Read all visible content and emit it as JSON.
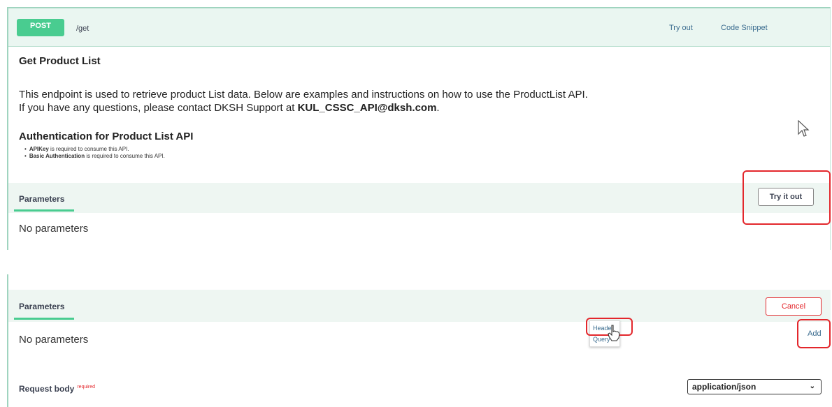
{
  "endpoint": {
    "method": "POST",
    "path": "/get",
    "try_out": "Try out",
    "code_snippet": "Code Snippet"
  },
  "description": {
    "title": "Get Product List",
    "line1": "This endpoint is used to retrieve product List data. Below are examples and instructions on how to use the ProductList API.",
    "line2_prefix": "If you have any questions, please contact DKSH Support at ",
    "line2_email": "KUL_CSSC_API@dksh.com",
    "line2_suffix": ".",
    "auth_title": "Authentication for Product List API",
    "auth_items": [
      {
        "bold": "APIKey",
        "rest": " is required to consume this API."
      },
      {
        "bold": "Basic Authentication",
        "rest": " is required to consume this API."
      }
    ]
  },
  "params_top": {
    "tab_label": "Parameters",
    "empty_text": "No parameters",
    "try_it_out": "Try it out"
  },
  "params_bottom": {
    "tab_label": "Parameters",
    "empty_text": "No parameters",
    "cancel": "Cancel",
    "add": "Add",
    "add_menu": [
      "Header",
      "Query"
    ],
    "request_body_label": "Request body",
    "required_tag": "required",
    "content_type": "application/json"
  },
  "colors": {
    "post_green": "#49cc90",
    "highlight_red": "#e3272c",
    "link_blue": "#3b6c8f"
  },
  "icons": [
    "mouse-pointer-icon",
    "hand-pointer-icon",
    "chevron-down-icon"
  ]
}
